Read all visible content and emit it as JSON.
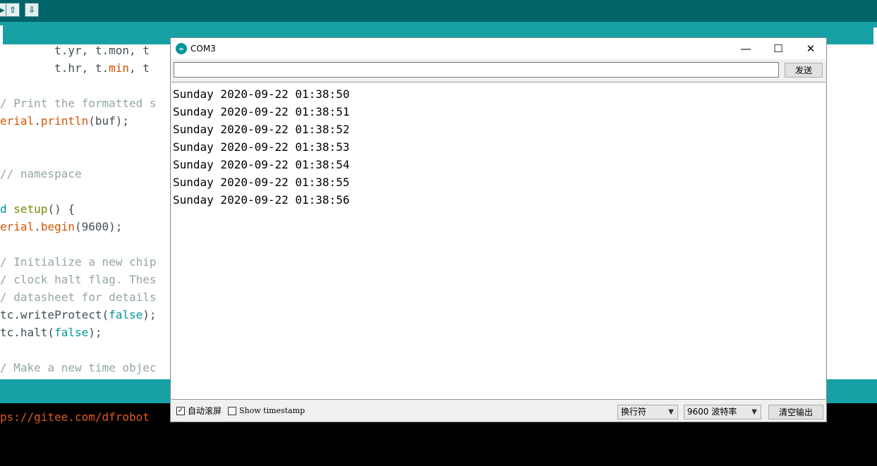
{
  "ide": {
    "code_lines": [
      {
        "segments": [
          {
            "t": "        t.yr, t.mon, t",
            "c": ""
          }
        ]
      },
      {
        "segments": [
          {
            "t": "        t.hr, t.",
            "c": ""
          },
          {
            "t": "min",
            "c": "c-kw"
          },
          {
            "t": ", t",
            "c": ""
          }
        ]
      },
      {
        "segments": []
      },
      {
        "segments": [
          {
            "t": "/ Print the formatted s",
            "c": "c-comment"
          }
        ]
      },
      {
        "segments": [
          {
            "t": "erial",
            "c": "c-kw"
          },
          {
            "t": ".",
            "c": ""
          },
          {
            "t": "println",
            "c": "c-kw"
          },
          {
            "t": "(buf);",
            "c": ""
          }
        ]
      },
      {
        "segments": []
      },
      {
        "segments": []
      },
      {
        "segments": [
          {
            "t": "// namespace",
            "c": "c-comment"
          }
        ]
      },
      {
        "segments": []
      },
      {
        "segments": [
          {
            "t": "d ",
            "c": "c-kw2"
          },
          {
            "t": "setup",
            "c": "c-type"
          },
          {
            "t": "() {",
            "c": ""
          }
        ]
      },
      {
        "segments": [
          {
            "t": "erial",
            "c": "c-kw"
          },
          {
            "t": ".",
            "c": ""
          },
          {
            "t": "begin",
            "c": "c-kw"
          },
          {
            "t": "(9600);",
            "c": ""
          }
        ]
      },
      {
        "segments": []
      },
      {
        "segments": [
          {
            "t": "/ Initialize a new chip",
            "c": "c-comment"
          }
        ]
      },
      {
        "segments": [
          {
            "t": "/ clock halt flag. Thes",
            "c": "c-comment"
          }
        ]
      },
      {
        "segments": [
          {
            "t": "/ datasheet for details",
            "c": "c-comment"
          }
        ]
      },
      {
        "segments": [
          {
            "t": "tc.writeProtect(",
            "c": ""
          },
          {
            "t": "false",
            "c": "c-kw2"
          },
          {
            "t": ");",
            "c": ""
          }
        ]
      },
      {
        "segments": [
          {
            "t": "tc.halt(",
            "c": ""
          },
          {
            "t": "false",
            "c": "c-kw2"
          },
          {
            "t": ");",
            "c": ""
          }
        ]
      },
      {
        "segments": []
      },
      {
        "segments": [
          {
            "t": "/ Make a new time objec",
            "c": "c-comment"
          }
        ]
      }
    ],
    "console_text": "ps://gitee.com/dfrobot"
  },
  "serial": {
    "title": "COM3",
    "minimize": "—",
    "maximize": "☐",
    "close": "✕",
    "input_value": "",
    "send_label": "发送",
    "lines": [
      "Sunday 2020-09-22 01:38:50",
      "Sunday 2020-09-22 01:38:51",
      "Sunday 2020-09-22 01:38:52",
      "Sunday 2020-09-22 01:38:53",
      "Sunday 2020-09-22 01:38:54",
      "Sunday 2020-09-22 01:38:55",
      "Sunday 2020-09-22 01:38:56"
    ],
    "autoscroll_label": "自动滚屏",
    "autoscroll_checked": true,
    "timestamp_label": "Show timestamp",
    "timestamp_checked": false,
    "line_ending": "换行符",
    "baud": "9600 波特率",
    "clear_label": "清空输出"
  }
}
